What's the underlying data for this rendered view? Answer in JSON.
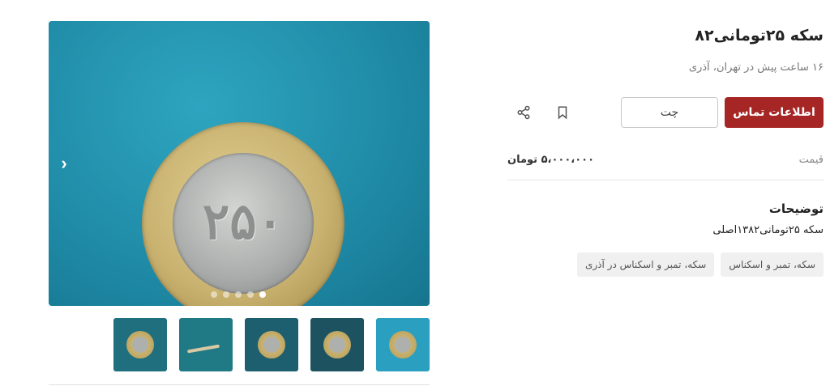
{
  "listing": {
    "title": "سکه ۲۵تومانی۸۲",
    "subtitle": "۱۶ ساعت پیش در تهران، آذری"
  },
  "actions": {
    "contact_label": "اطلاعات تماس",
    "chat_label": "چت",
    "bookmark_icon": "bookmark-icon",
    "share_icon": "share-icon"
  },
  "price": {
    "label": "قیمت",
    "value": "۵،۰۰۰،۰۰۰ تومان"
  },
  "description": {
    "heading": "توضیحات",
    "text": "سکه ۲۵تومانی۱۳۸۲اصلی"
  },
  "tags": [
    "سکه، تمبر و اسکناس",
    "سکه، تمبر و اسکناس در آذری"
  ],
  "gallery": {
    "coin_numeral": "۲۵۰",
    "arrow_icon": "chevron-right-icon",
    "dot_count": 5,
    "active_dot": 5,
    "thumbnail_count": 5
  },
  "colors": {
    "primary": "#a62626",
    "tag_bg": "#f0f0f0"
  }
}
